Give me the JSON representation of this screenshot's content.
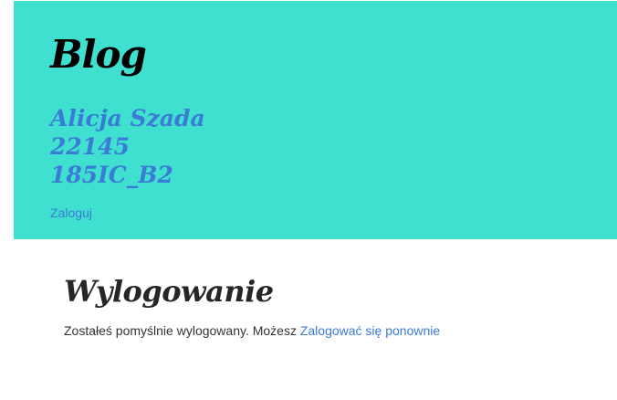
{
  "colors": {
    "header_bg": "#40e0d0",
    "accent_blue": "#3a7bd5",
    "title_dark": "#000000",
    "text": "#333333"
  },
  "header": {
    "title": "Blog",
    "author_lines": [
      "Alicja Szada",
      "22145",
      "185IC_B2"
    ],
    "login_link": "Zaloguj"
  },
  "main": {
    "title": "Wylogowanie",
    "message": "Zostałeś pomyślnie wylogowany. Możesz ",
    "relogin_link": "Zalogować się ponownie"
  }
}
